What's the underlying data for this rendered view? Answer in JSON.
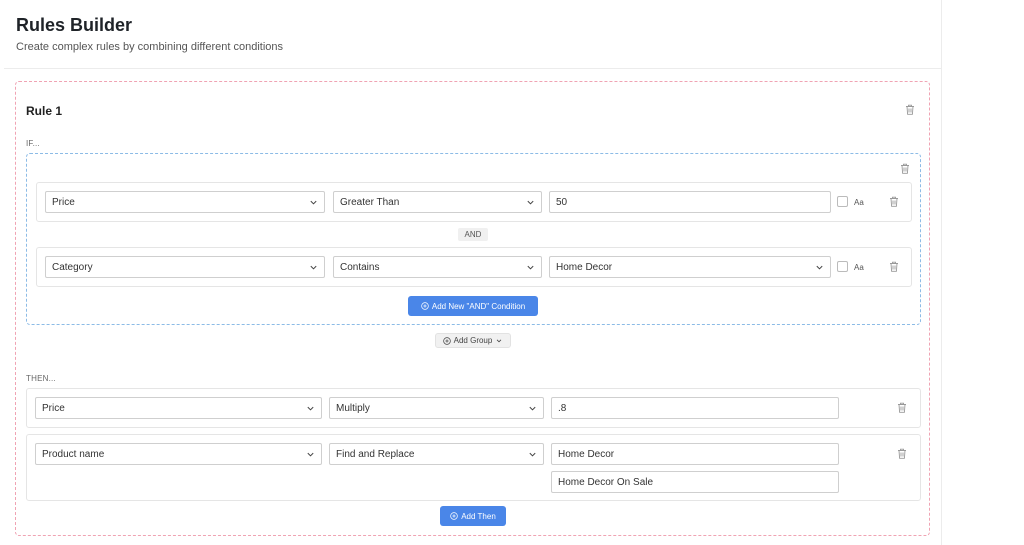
{
  "header": {
    "title": "Rules Builder",
    "subtitle": "Create complex rules by combining different conditions"
  },
  "rule": {
    "title": "Rule 1",
    "if_label": "IF...",
    "then_label": "THEN...",
    "conditions": [
      {
        "field": "Price",
        "operator": "Greater Than",
        "value": "50",
        "case_label": "Aa"
      },
      {
        "field": "Category",
        "operator": "Contains",
        "value": "Home Decor",
        "case_label": "Aa"
      }
    ],
    "and_badge": "AND",
    "add_and_label": "Add New \"AND\" Condition",
    "add_group_label": "Add Group",
    "actions": [
      {
        "field": "Price",
        "operation": "Multiply",
        "value": ".8"
      },
      {
        "field": "Product name",
        "operation": "Find and Replace",
        "find": "Home Decor",
        "replace": "Home Decor On Sale"
      }
    ],
    "add_then_label": "Add Then"
  },
  "colors": {
    "primary": "#4a86e8",
    "rule_border": "#f0a3b3",
    "group_border": "#8cbbe6"
  },
  "icons": [
    "trash-icon",
    "chevron-down-icon",
    "plus-circle-icon"
  ]
}
